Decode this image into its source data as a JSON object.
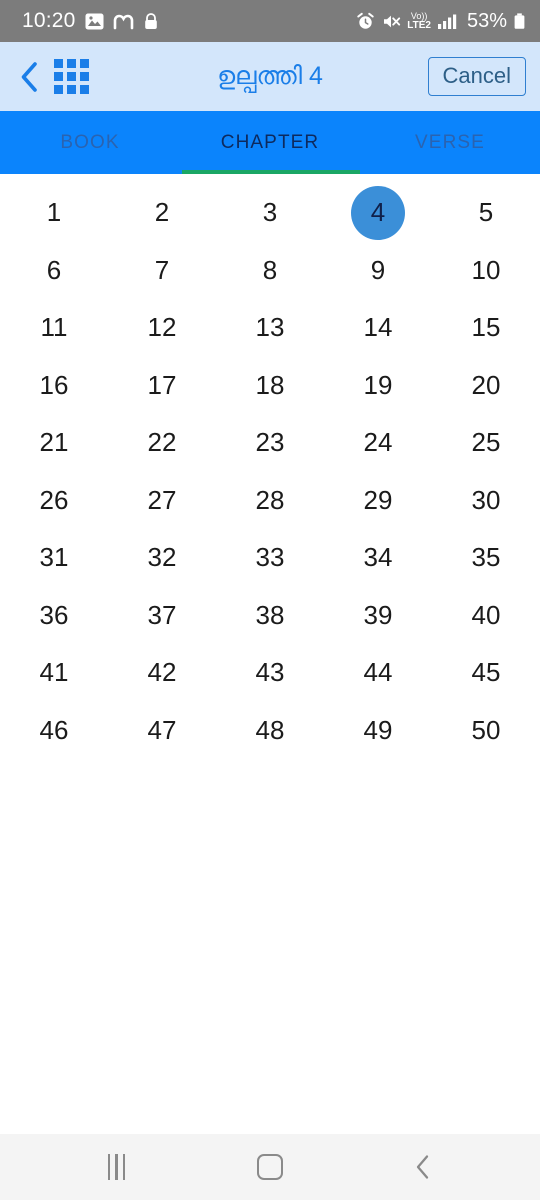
{
  "status_bar": {
    "time": "10:20",
    "left_icons": [
      "image-icon",
      "m-app-icon",
      "lock-icon"
    ],
    "right_icons": [
      "alarm-icon",
      "volume-mute-icon",
      "volte2-icon",
      "signal-bars-icon"
    ],
    "network_label": "Vo))",
    "network_sub_label": "LTE2",
    "battery_percent": "53%",
    "background_color": "#7c7c7c"
  },
  "header": {
    "back_icon": "chevron-left-icon",
    "grid_icon": "grid-3x3-icon",
    "title": "ഉല്പത്തി 4",
    "cancel_label": "Cancel",
    "background_color": "#d3e6fb",
    "accent_color": "#1a7ee8"
  },
  "tabs": {
    "items": [
      {
        "label": "BOOK",
        "active": false
      },
      {
        "label": "CHAPTER",
        "active": true
      },
      {
        "label": "VERSE",
        "active": false
      }
    ],
    "background_color": "#0b84fc",
    "indicator_color": "#1aa765",
    "active_text_color": "#0d2a5e",
    "inactive_text_color": "#2a63b0"
  },
  "chapter_grid": {
    "columns": 5,
    "selected": 4,
    "selected_bubble_color": "#3b8fd8",
    "numbers": [
      "1",
      "2",
      "3",
      "4",
      "5",
      "6",
      "7",
      "8",
      "9",
      "10",
      "11",
      "12",
      "13",
      "14",
      "15",
      "16",
      "17",
      "18",
      "19",
      "20",
      "21",
      "22",
      "23",
      "24",
      "25",
      "26",
      "27",
      "28",
      "29",
      "30",
      "31",
      "32",
      "33",
      "34",
      "35",
      "36",
      "37",
      "38",
      "39",
      "40",
      "41",
      "42",
      "43",
      "44",
      "45",
      "46",
      "47",
      "48",
      "49",
      "50"
    ]
  },
  "nav_bar": {
    "recents_icon": "recents-icon",
    "home_icon": "home-icon",
    "back_icon": "back-icon",
    "background_color": "#f4f4f4"
  }
}
